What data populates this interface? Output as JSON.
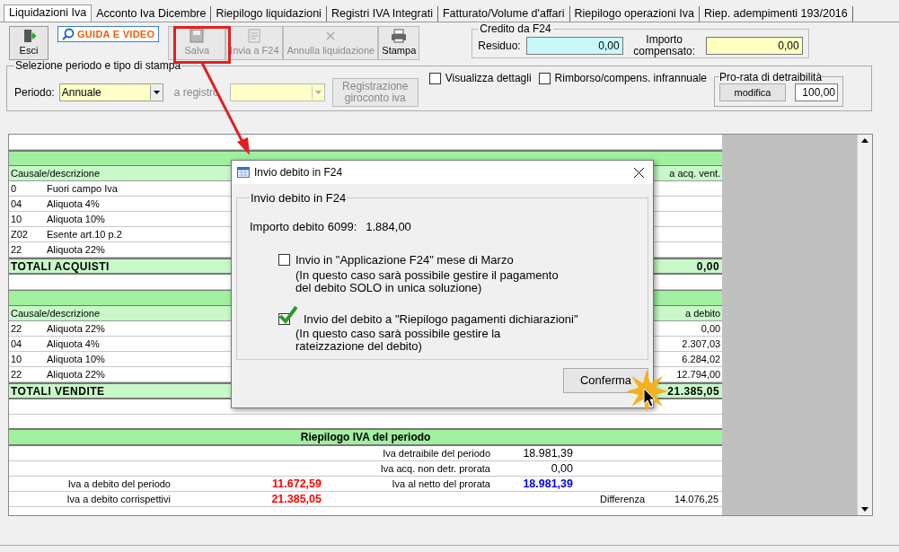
{
  "tabs": [
    {
      "label": "Liquidazioni Iva",
      "selected": true
    },
    {
      "label": "Acconto Iva Dicembre",
      "selected": false
    },
    {
      "label": "Riepilogo liquidazioni",
      "selected": false
    },
    {
      "label": "Registri IVA Integrati",
      "selected": false
    },
    {
      "label": "Fatturato/Volume d'affari",
      "selected": false
    },
    {
      "label": "Riepilogo operazioni Iva",
      "selected": false
    },
    {
      "label": "Riep. adempimenti 193/2016",
      "selected": false
    }
  ],
  "toolbar": {
    "exit": {
      "label": "Esci"
    },
    "guide": {
      "label": "GUIDA E VIDEO"
    },
    "buttons": [
      {
        "kind": "save",
        "label": "Salva",
        "disabled": true
      },
      {
        "kind": "f24",
        "label": "Invia a F24",
        "disabled": true
      },
      {
        "kind": "cancel",
        "label": "Annulla liquidazione",
        "disabled": true
      },
      {
        "kind": "print",
        "label": "Stampa",
        "disabled": false
      }
    ]
  },
  "credit": {
    "title": "Credito da F24",
    "residuo_label": "Residuo:",
    "residuo_value": "0,00",
    "importo_label": "Importo compensato:",
    "importo_value": "0,00"
  },
  "period": {
    "title": "Selezione periodo e tipo di stampa",
    "periodo_label": "Periodo:",
    "periodo_value": "Annuale",
    "registro_label": "a registro",
    "giroconto_button": "Registrazione giroconto iva"
  },
  "checkboxes": [
    {
      "label": "Visualizza dettagli",
      "checked": false
    },
    {
      "label": "Rimborso/compens. infrannuale",
      "checked": false
    }
  ],
  "prorata": {
    "title": "Pro-rata di detraibilità",
    "button": "modifica",
    "value": "100,00"
  },
  "purchases": {
    "columns": [
      "Causale/descrizione",
      "a acq. vent."
    ],
    "rows": [
      {
        "code": "0",
        "description": "Fuori campo Iva"
      },
      {
        "code": "04",
        "description": "Aliquota 4%"
      },
      {
        "code": "10",
        "description": "Aliquota 10%"
      },
      {
        "code": "Z02",
        "description": "Esente art.10 p.2"
      },
      {
        "code": "22",
        "description": "Aliquota 22%"
      }
    ],
    "total": {
      "label": "TOTALI ACQUISTI",
      "value": "0,00"
    }
  },
  "sales": {
    "columns": [
      "Causale/descrizione",
      "a debito"
    ],
    "rows": [
      {
        "code": "22",
        "description": "Aliquota 22%",
        "amount": "0,00"
      },
      {
        "code": "04",
        "description": "Aliquota 4%",
        "amount": "2.307,03"
      },
      {
        "code": "10",
        "description": "Aliquota 10%",
        "amount": "6.284,02"
      },
      {
        "code": "22",
        "description": "Aliquota 22%",
        "amount": "12.794,00"
      }
    ],
    "total": {
      "label": "TOTALI VENDITE",
      "value": "21.385,05"
    }
  },
  "summary": {
    "title": "Riepilogo IVA del periodo",
    "rows": [
      {
        "mid_label": "Iva detraibile del periodo",
        "mid_value": {
          "text": "18.981,39",
          "color": "#000000",
          "bold": false
        }
      },
      {
        "mid_label": "Iva acq. non detr. prorata",
        "mid_value": {
          "text": "0,00",
          "color": "#000000",
          "bold": false
        }
      },
      {
        "left_label": "Iva a debito del periodo",
        "left_value": {
          "text": "11.672,59",
          "color": "#ff0000",
          "bold": true
        },
        "mid_label": "Iva al netto del prorata",
        "mid_value": {
          "text": "18.981,39",
          "color": "#0000ff",
          "bold": true
        }
      },
      {
        "left_label": "Iva a debito corrispettivi",
        "left_value": {
          "text": "21.385,05",
          "color": "#ff0000",
          "bold": true
        },
        "right_label": "Differenza",
        "right_value": "14.076,25"
      }
    ]
  },
  "dialog": {
    "title": "Invio debito in F24",
    "group_title": "Invio debito in F24",
    "amount_label": "Importo debito 6099:",
    "amount": "1.884,00",
    "options": [
      {
        "label": "Invio in \"Applicazione F24\" mese di Marzo",
        "note": "(In questo caso sarà possibile gestire il pagamento del debito SOLO in unica soluzione)",
        "checked": false
      },
      {
        "label": "Invio del debito a \"Riepilogo pagamenti dichiarazioni\"",
        "note": "(In questo caso sarà possibile gestire la rateizzazione del debito)",
        "checked": true
      }
    ],
    "confirm": "Conferma"
  }
}
